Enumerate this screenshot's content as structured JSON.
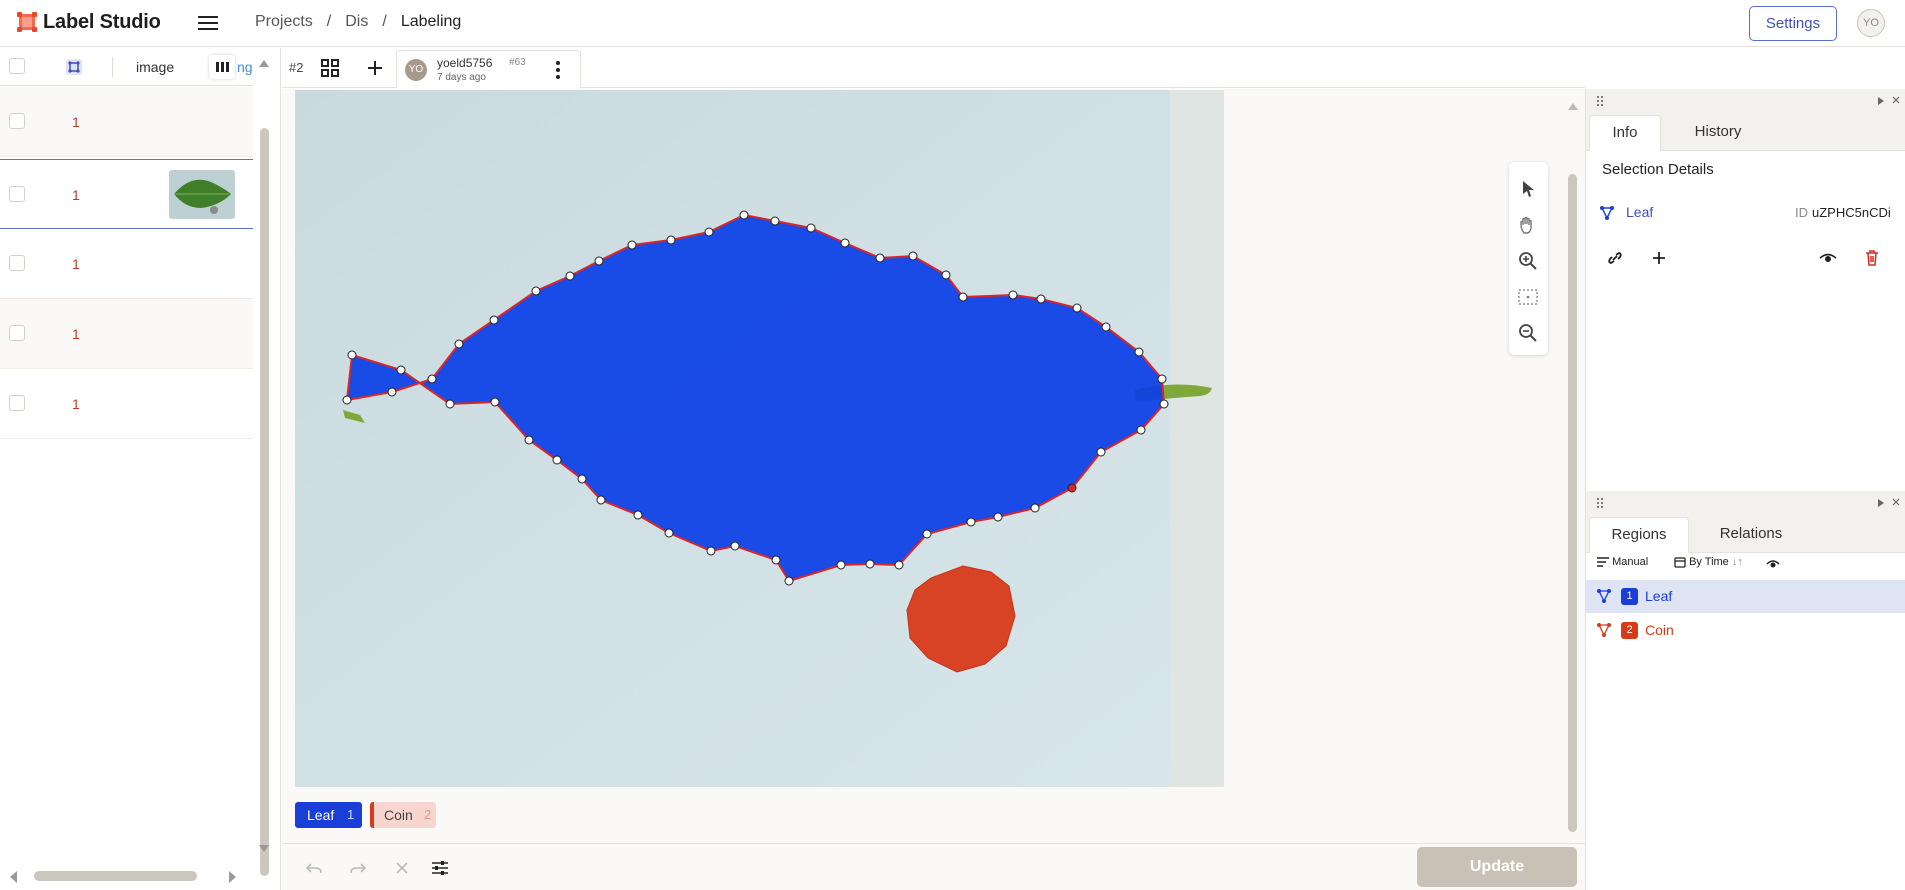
{
  "app": {
    "name": "Label Studio"
  },
  "breadcrumb": {
    "projects": "Projects",
    "project": "Dis",
    "page": "Labeling"
  },
  "header": {
    "settings_label": "Settings",
    "avatar_initials": "YO"
  },
  "data_manager": {
    "column_header": "image",
    "column_truncated": "ng",
    "rows": [
      {
        "value": "1",
        "has_thumbnail": false
      },
      {
        "value": "1",
        "has_thumbnail": true
      },
      {
        "value": "1",
        "has_thumbnail": false
      },
      {
        "value": "1",
        "has_thumbnail": false
      },
      {
        "value": "1",
        "has_thumbnail": false
      }
    ]
  },
  "annotation_tabs": {
    "task_id": "#2",
    "annotator": "yoeld5756",
    "annotation_id": "#63",
    "time_ago": "7 days ago",
    "avatar_initials": "YO"
  },
  "labels": [
    {
      "name": "Leaf",
      "hotkey": "1",
      "color": "#1a3fd8"
    },
    {
      "name": "Coin",
      "hotkey": "2",
      "color": "#d83a1a"
    }
  ],
  "bottom_bar": {
    "update_label": "Update"
  },
  "info_panel": {
    "tabs": [
      "Info",
      "History"
    ],
    "active_tab": "Info",
    "section_title": "Selection Details",
    "selected_label": "Leaf",
    "id_label": "ID",
    "id_value": "uZPHC5nCDi"
  },
  "regions_panel": {
    "tabs": [
      "Regions",
      "Relations"
    ],
    "active_tab": "Regions",
    "sort_manual": "Manual",
    "sort_by_time": "By Time",
    "regions": [
      {
        "index": "1",
        "label": "Leaf",
        "color": "#1a3fd8",
        "selected": true
      },
      {
        "index": "2",
        "label": "Coin",
        "color": "#d83a1a",
        "selected": false
      }
    ]
  },
  "colors": {
    "accent": "#3f51b5",
    "leaf": "#1a3fd8",
    "coin": "#d83a1a",
    "selection_bg": "#dfe4f5"
  }
}
